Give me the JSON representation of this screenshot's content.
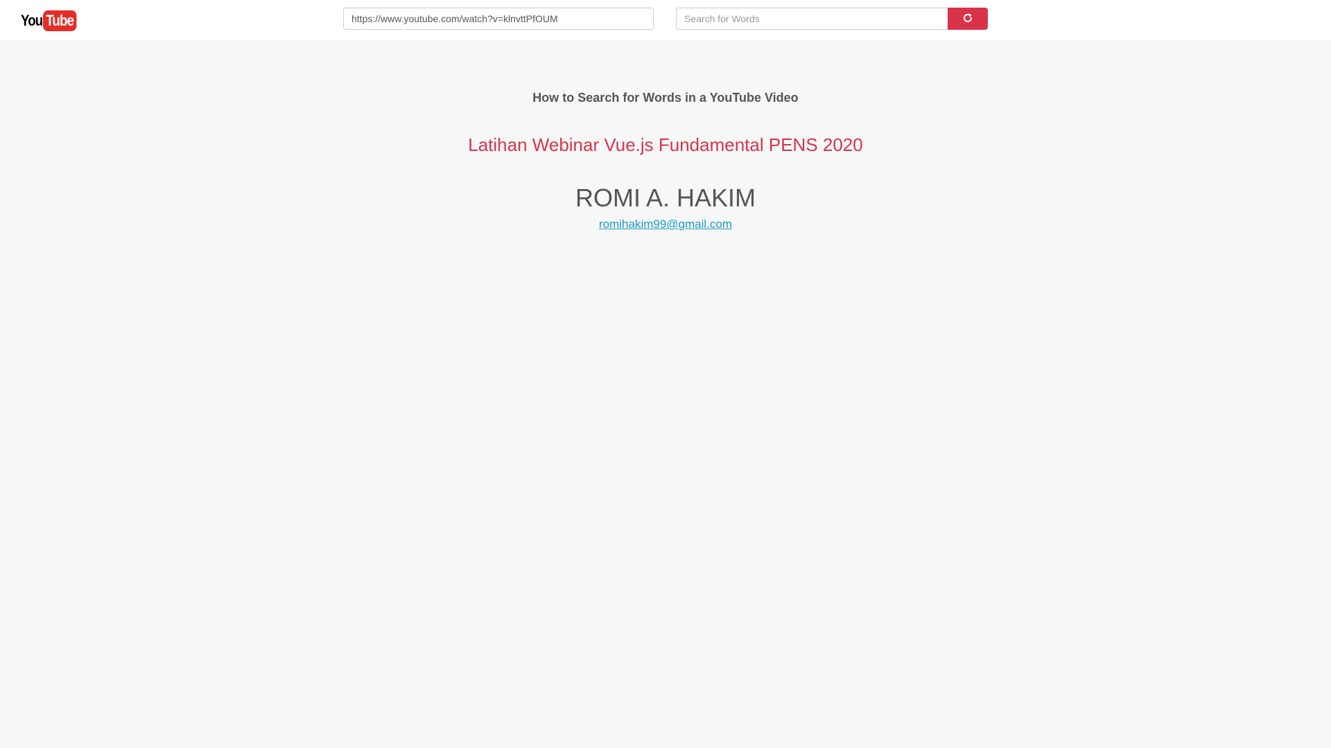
{
  "header": {
    "logo": {
      "part1": "You",
      "part2": "Tube"
    },
    "url_input": {
      "value": "https://www.youtube.com/watch?v=klnvttPfOUM"
    },
    "search": {
      "placeholder": "Search for Words",
      "button_icon": "refresh-icon"
    }
  },
  "main": {
    "heading": "How to Search for Words in a YouTube Video",
    "video_title": "Latihan Webinar Vue.js Fundamental PENS 2020",
    "author": "ROMI A. HAKIM",
    "email": "romihakim99@gmail.com"
  },
  "colors": {
    "accent": "#d9334a",
    "link": "#1a9bc8",
    "text": "#555555",
    "background": "#f7f7f7"
  }
}
